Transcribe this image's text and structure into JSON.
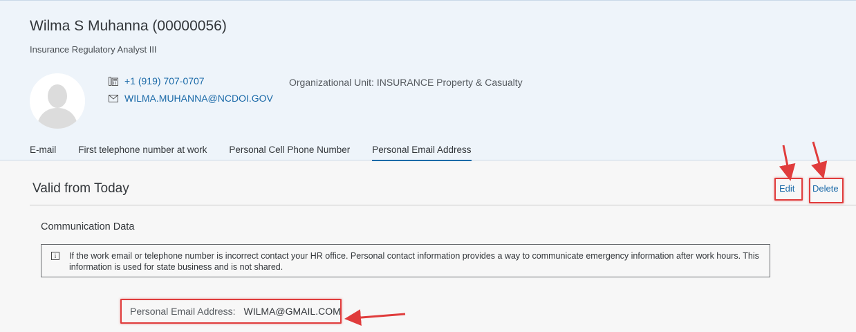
{
  "employee": {
    "name": "Wilma S Muhanna (00000056)",
    "job_title": "Insurance Regulatory Analyst III"
  },
  "contact": {
    "phone": "+1 (919) 707-0707",
    "email": "WILMA.MUHANNA@NCDOI.GOV",
    "org_unit": "Organizational Unit: INSURANCE Property & Casualty"
  },
  "tabs": [
    {
      "label": "E-mail"
    },
    {
      "label": "First telephone number at work"
    },
    {
      "label": "Personal Cell Phone Number"
    },
    {
      "label": "Personal Email Address",
      "active": true
    }
  ],
  "section": {
    "title": "Valid from Today",
    "edit_label": "Edit",
    "delete_label": "Delete"
  },
  "communication": {
    "title": "Communication Data",
    "info_text": "If the work email or telephone number is incorrect contact your HR office. Personal contact information provides a way to communicate emergency information after work hours. This information is used for state business and is not shared.",
    "field_label": "Personal Email Address:",
    "field_value": "WILMA@GMAIL.COM"
  },
  "colors": {
    "header_bg": "#eef4fa",
    "link": "#1b6aa8",
    "annotation": "#e03c3c"
  }
}
